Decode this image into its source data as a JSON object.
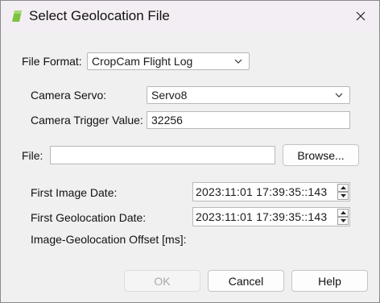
{
  "window": {
    "title": "Select Geolocation File",
    "icon": "green-leaf-icon",
    "close_icon": "close-icon"
  },
  "form": {
    "file_format_label": "File Format:",
    "file_format_value": "CropCam Flight Log",
    "camera_servo_label": "Camera Servo:",
    "camera_servo_value": "Servo8",
    "camera_trigger_label": "Camera Trigger Value:",
    "camera_trigger_value": "32256",
    "file_label": "File:",
    "file_value": "",
    "browse_label": "Browse...",
    "first_image_date_label": "First Image Date:",
    "first_image_date_value": "2023:11:01 17:39:35::143",
    "first_geolocation_date_label": "First Geolocation Date:",
    "first_geolocation_date_value": "2023:11:01 17:39:35::143",
    "offset_label": "Image-Geolocation Offset [ms]:"
  },
  "buttons": {
    "ok": "OK",
    "cancel": "Cancel",
    "help": "Help"
  },
  "colors": {
    "icon_green": "#7cc243",
    "background": "#f0f0f0",
    "titlebar": "#f3eef3"
  }
}
